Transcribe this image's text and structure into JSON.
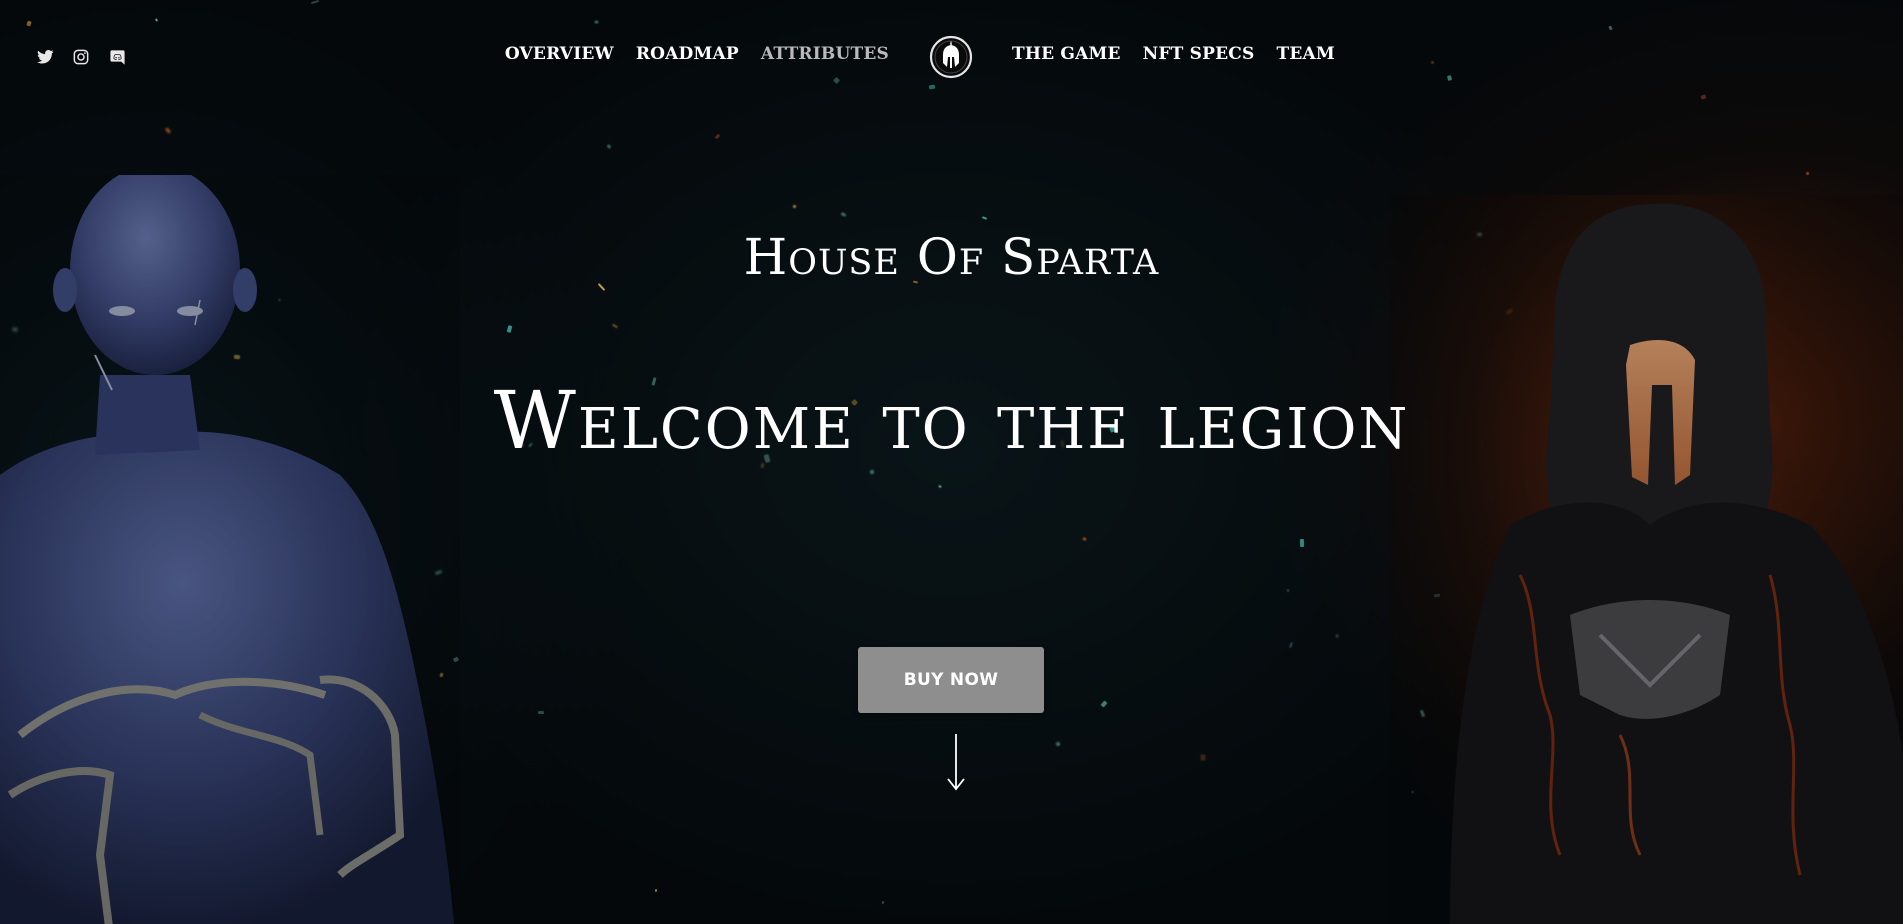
{
  "header": {
    "social": [
      {
        "icon": "twitter-icon",
        "label": "Twitter"
      },
      {
        "icon": "instagram-icon",
        "label": "Instagram"
      },
      {
        "icon": "discord-icon",
        "label": "Discord"
      }
    ],
    "nav_left": [
      {
        "label": "OVERVIEW"
      },
      {
        "label": "ROADMAP"
      },
      {
        "label": "ATTRIBUTES"
      }
    ],
    "nav_right": [
      {
        "label": "THE GAME"
      },
      {
        "label": "NFT SPECS"
      },
      {
        "label": "TEAM"
      }
    ],
    "logo_icon": "spartan-helmet-icon"
  },
  "hero": {
    "subtitle": "House Of Sparta",
    "title": "Welcome to the legion",
    "cta_label": "BUY NOW",
    "scroll_icon": "arrow-down-icon"
  },
  "colors": {
    "background": "#050607",
    "text": "#ffffff",
    "nav_muted": "#b9b9b9",
    "button_bg": "#8e8e8e",
    "figure_left": "#5a6aa8",
    "figure_right_glow": "#c8501a"
  }
}
